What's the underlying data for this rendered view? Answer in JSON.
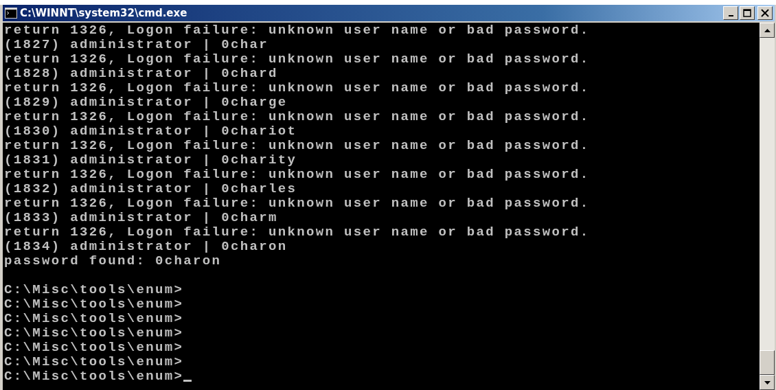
{
  "window": {
    "title": "C:\\WINNT\\system32\\cmd.exe"
  },
  "console": {
    "lines": [
      "return 1326, Logon failure: unknown user name or bad password.",
      "(1827) administrator | 0char",
      "return 1326, Logon failure: unknown user name or bad password.",
      "(1828) administrator | 0chard",
      "return 1326, Logon failure: unknown user name or bad password.",
      "(1829) administrator | 0charge",
      "return 1326, Logon failure: unknown user name or bad password.",
      "(1830) administrator | 0chariot",
      "return 1326, Logon failure: unknown user name or bad password.",
      "(1831) administrator | 0charity",
      "return 1326, Logon failure: unknown user name or bad password.",
      "(1832) administrator | 0charles",
      "return 1326, Logon failure: unknown user name or bad password.",
      "(1833) administrator | 0charm",
      "return 1326, Logon failure: unknown user name or bad password.",
      "(1834) administrator | 0charon",
      "password found: 0charon"
    ],
    "prompts": [
      "C:\\Misc\\tools\\enum>",
      "C:\\Misc\\tools\\enum>",
      "C:\\Misc\\tools\\enum>",
      "C:\\Misc\\tools\\enum>",
      "C:\\Misc\\tools\\enum>",
      "C:\\Misc\\tools\\enum>",
      "C:\\Misc\\tools\\enum>"
    ],
    "cursor": true
  }
}
